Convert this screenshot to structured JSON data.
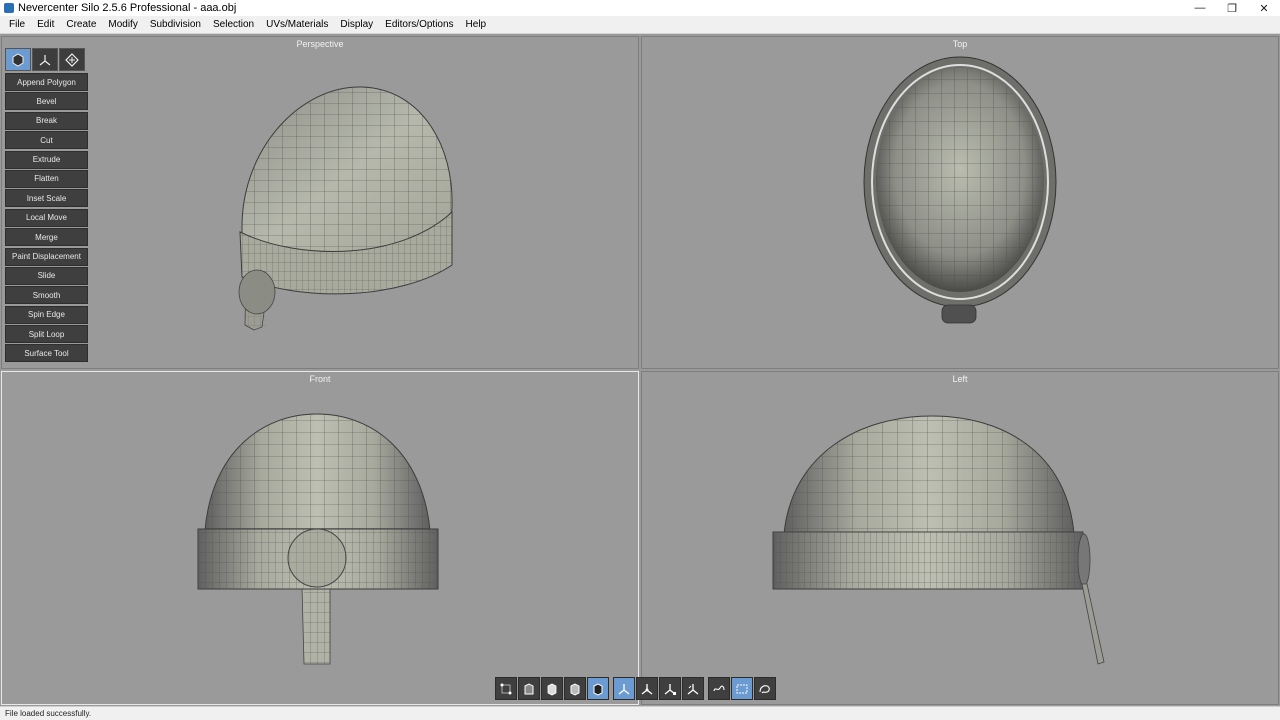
{
  "window": {
    "title": "Nevercenter Silo 2.5.6 Professional - aaa.obj",
    "minimize": "—",
    "restore": "❐",
    "close": "✕"
  },
  "menu": [
    "File",
    "Edit",
    "Create",
    "Modify",
    "Subdivision",
    "Selection",
    "UVs/Materials",
    "Display",
    "Editors/Options",
    "Help"
  ],
  "viewports": {
    "perspective": "Perspective",
    "top": "Top",
    "front": "Front",
    "left": "Left"
  },
  "tools": [
    "Append Polygon",
    "Bevel",
    "Break",
    "Cut",
    "Extrude",
    "Flatten",
    "Inset Scale",
    "Local Move",
    "Merge",
    "Paint Displacement",
    "Slide",
    "Smooth",
    "Spin Edge",
    "Split Loop",
    "Surface Tool"
  ],
  "status": "File loaded successfully.",
  "colors": {
    "viewport_bg": "#9a9a9a",
    "accent": "#6b9bd1",
    "panel_button": "#3f3f3f"
  }
}
